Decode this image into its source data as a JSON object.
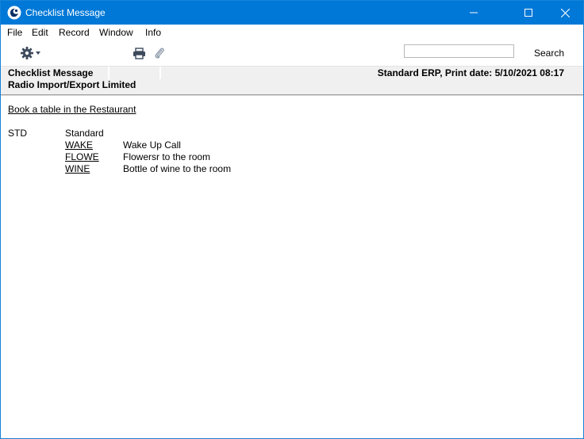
{
  "window": {
    "title": "Checklist Message"
  },
  "menu": {
    "items": [
      {
        "label": "File"
      },
      {
        "label": "Edit"
      },
      {
        "label": "Record"
      },
      {
        "label": "Window"
      },
      {
        "label": "Info"
      }
    ]
  },
  "toolbar": {
    "search_value": "",
    "search_button_label": "Search",
    "icons": [
      "gear-icon",
      "chevron-down-icon",
      "printer-icon",
      "paperclip-icon"
    ]
  },
  "report_header": {
    "report_name": "Checklist Message",
    "company": "Radio Import/Export Limited",
    "print_info": "Standard ERP, Print date: 5/10/2021 08:17"
  },
  "report": {
    "title_link": "Book a table in the Restaurant",
    "checklist": {
      "code": "STD",
      "name": "Standard",
      "items": [
        {
          "code": "WAKE",
          "description": "Wake Up Call"
        },
        {
          "code": "FLOWE",
          "description": "Flowersr to the room"
        },
        {
          "code": "WINE",
          "description": "Bottle of wine to the room"
        }
      ]
    }
  },
  "colors": {
    "titlebar": "#0078d7",
    "header_band": "#f0f0f0",
    "icon_gray": "#3c4a5c"
  }
}
